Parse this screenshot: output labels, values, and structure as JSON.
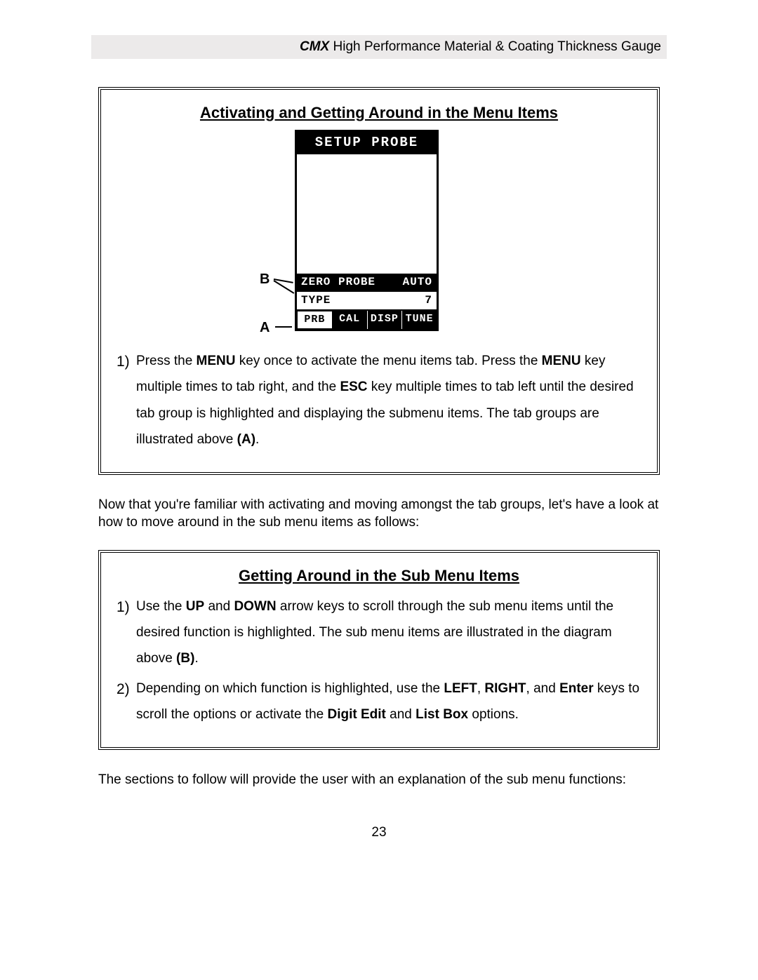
{
  "header": {
    "brand": "CMX",
    "rest": " High Performance Material & Coating Thickness Gauge"
  },
  "box1": {
    "title": "Activating and Getting Around in the Menu Items",
    "label_b": "B",
    "label_a": "A",
    "lcd": {
      "title": "SETUP PROBE",
      "row1_left": "ZERO PROBE",
      "row1_right": "AUTO",
      "row2_left": "TYPE",
      "row2_right": "7",
      "tabs": [
        "PRB",
        "CAL",
        "DISP",
        "TUNE"
      ],
      "active_tab_index": 0
    },
    "step1": {
      "num": "1)",
      "t1": "Press the ",
      "b1": "MENU",
      "t2": " key once to activate the menu items tab.  Press the ",
      "b2": "MENU",
      "t3": " key multiple times to tab right, and the ",
      "b3": "ESC",
      "t4": " key multiple times to tab left until the desired tab group is highlighted and displaying the submenu items.  The tab groups are illustrated above ",
      "b4": "(A)",
      "t5": "."
    }
  },
  "mid_para": "Now that you're familiar with activating and moving amongst the tab groups, let's have a look at how to move around in the sub menu items as follows:",
  "box2": {
    "title": "Getting Around in the Sub Menu Items",
    "step1": {
      "num": "1)",
      "t1": "Use the ",
      "b1": "UP",
      "t2": " and ",
      "b2": "DOWN",
      "t3": " arrow keys to scroll through the sub menu items until the desired function is highlighted.  The sub menu items are illustrated in the diagram above ",
      "b3": "(B)",
      "t4": "."
    },
    "step2": {
      "num": "2)",
      "t1": "Depending on which function is highlighted, use the ",
      "b1": "LEFT",
      "t2": ", ",
      "b2": "RIGHT",
      "t3": ", and ",
      "b3": "Enter",
      "t4": " keys to scroll the options or activate the ",
      "b4": "Digit Edit",
      "t5": " and ",
      "b5": "List Box",
      "t6": " options."
    }
  },
  "end_para": "The sections to follow will provide the user with an explanation of the sub menu functions:",
  "page_number": "23"
}
